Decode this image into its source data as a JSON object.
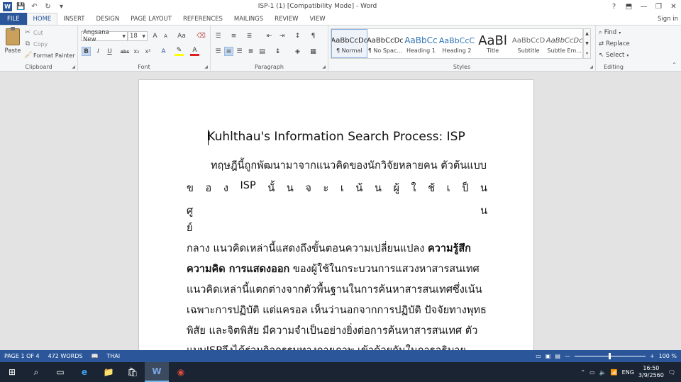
{
  "window": {
    "title": "ISP-1 (1) [Compatibility Mode] - Word",
    "help": "?",
    "controls": {
      "ribbon_options": "⬒",
      "minimize": "—",
      "maximize": "❐",
      "close": "✕"
    }
  },
  "qat": {
    "logo": "W",
    "save": "💾",
    "undo": "↶",
    "redo": "↻",
    "more": "▾"
  },
  "tabs": {
    "file": "FILE",
    "items": [
      "HOME",
      "INSERT",
      "DESIGN",
      "PAGE LAYOUT",
      "REFERENCES",
      "MAILINGS",
      "REVIEW",
      "VIEW"
    ],
    "active": "HOME",
    "signin": "Sign in"
  },
  "clipboard": {
    "label": "Clipboard",
    "paste": "Paste",
    "cut": "Cut",
    "copy": "Copy",
    "format_painter": "Format Painter"
  },
  "font": {
    "label": "Font",
    "family": "Angsana New",
    "size": "18",
    "grow": "A",
    "shrink": "A",
    "case": "Aa",
    "bold": "B",
    "italic": "I",
    "underline": "U",
    "strike": "abc",
    "subscript": "x₂",
    "superscript": "x²"
  },
  "paragraph": {
    "label": "Paragraph",
    "pilcrow": "¶"
  },
  "styles": {
    "label": "Styles",
    "items": [
      {
        "sample": "AaBbCcDc",
        "name": "¶ Normal"
      },
      {
        "sample": "AaBbCcDc",
        "name": "¶ No Spac..."
      },
      {
        "sample": "AaBbCc",
        "name": "Heading 1"
      },
      {
        "sample": "AaBbCcC",
        "name": "Heading 2"
      },
      {
        "sample": "AaBl",
        "name": "Title"
      },
      {
        "sample": "AaBbCcD",
        "name": "Subtitle"
      },
      {
        "sample": "AaBbCcDc",
        "name": "Subtle Em..."
      }
    ],
    "selected_index": 0
  },
  "editing": {
    "label": "Editing",
    "find": "Find",
    "replace": "Replace",
    "select": "Select"
  },
  "document": {
    "title": "Kuhlthau's Information Search Process: ISP",
    "line1": "ทฤษฎีนี้ถูกพัฒนามาจากแนวคิดของนักวิจัยหลายคน ตัวต้นแบบ",
    "line2_tokens": [
      "ข",
      "อ",
      "ง",
      "ISP",
      "นั้",
      "น",
      "จ",
      "ะ",
      "เ",
      "น้",
      "น",
      "ผู้",
      "ใ",
      "ช้",
      "เ",
      "ป็",
      "น"
    ],
    "line3_tokens": [
      "ศู",
      "น"
    ],
    "line4": "ย์",
    "line5_plain": "กลาง แนวคิดเหล่านี้แสดงถึงขั้นตอนความเปลี่ยนแปลง ",
    "line5_bold": "ความรู้สึก",
    "line6_bold": "ความคิด การแสดงออก",
    "line6_plain": " ของผู้ใช้ในกระบวนการแสวงหาสารสนเทศ",
    "line7": "แนวคิดเหล่านี้แตกต่างจากตัวพื้นฐานในการค้นหาสารสนเทศซึ่งเน้น",
    "line8": "เฉพาะการปฏิบัติ แต่แครอล เห็นว่านอกจากการปฏิบัติ ปัจจัยทางพุทธ",
    "line9": "พิสัย และจิตพิสัย มีความจำเป็นอย่างยิ่งต่อการค้นหาสารสนเทศ ตัว",
    "line10": "แบบISPจึงได้ร่วมกิจกรรมทางกายภาพ เข้าด้วยกันในการอธิบาย"
  },
  "status": {
    "page": "PAGE 1 OF 4",
    "words": "472 WORDS",
    "language": "THAI",
    "zoom": "100 %",
    "zoom_out": "—",
    "zoom_in": "+",
    "zoom_level": 0.5
  },
  "taskbar": {
    "start": "⊞",
    "search": "⌕",
    "taskview": "▭",
    "edge": "e",
    "explorer": "📁",
    "store": "🛍",
    "word": "W",
    "chrome": "◉",
    "lang": "ENG",
    "time": "16:50",
    "date": "3/9/2560"
  },
  "colors": {
    "accent": "#2b579a",
    "taskbar": "#1a2433"
  }
}
